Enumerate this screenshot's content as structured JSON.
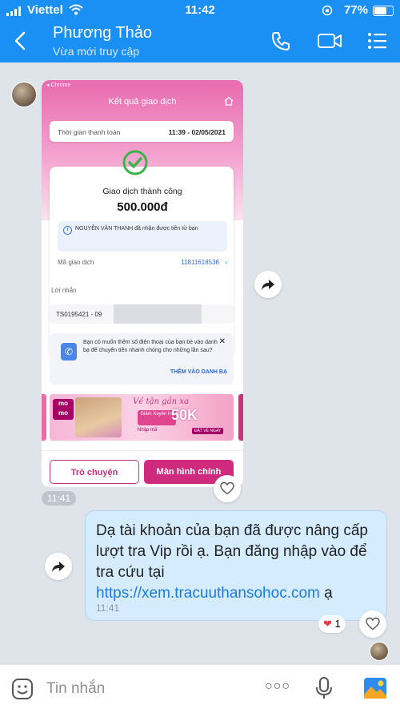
{
  "status_bar": {
    "carrier": "Viettel",
    "time": "11:42",
    "battery": "77%",
    "battery_level": 0.77
  },
  "header": {
    "name": "Phương Thảo",
    "status": "Vừa mới truy cập"
  },
  "receipt": {
    "browser": "◂ Chrome",
    "title": "Kết quả giao dịch",
    "time_label": "Thời gian thanh toán",
    "time_value": "11:39 - 02/05/2021",
    "status": "Giao dịch thành công",
    "amount": "500.000đ",
    "notice": "NGUYỄN VĂN THANH đã nhận được tiền từ bạn",
    "txn_label": "Mã giao dịch",
    "txn_value": "11811618536",
    "message_label": "Lời nhắn",
    "message_value": "TS0195421 - 09",
    "suggest_text": "Bạn có muốn thêm số điện thoại của bạn bè vào danh bạ để chuyển tiền nhanh chóng cho những lần sau?",
    "suggest_action": "THÊM VÀO DANH BẠ",
    "banner": {
      "logo": "mo mo",
      "title": "Về tận gần xa",
      "sub": "Giảm Xuyên hè",
      "big": "50K",
      "code": "Nhập mã",
      "button": "ĐẶT VÉ NGAY"
    },
    "btn_chat": "Trò chuyện",
    "btn_main": "Màn hình chính"
  },
  "image_time": "11:41",
  "reply": {
    "text_prefix": "Dạ tài khoản của bạn đã được nâng cấp lượt tra Vip rồi ạ. Bạn đăng nhập vào để tra cứu tại ",
    "link": "https://xem.tracuuthansohoc.com",
    "text_suffix": " ạ",
    "time": "11:41"
  },
  "reaction": {
    "emoji": "❤",
    "count": "1"
  },
  "composer": {
    "placeholder": "Tin nhắn",
    "more": "○○○"
  },
  "colors": {
    "header_blue": "#1a90f5",
    "momo_pink": "#d02a7f",
    "bubble": "#d5ecff"
  }
}
